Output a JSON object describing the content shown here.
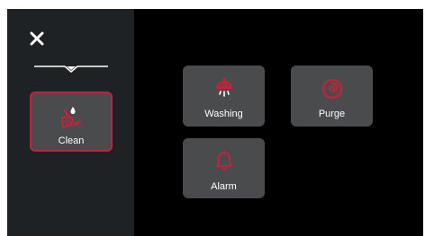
{
  "colors": {
    "background": "#000000",
    "sidebar": "#1f2225",
    "tile": "#4a4b4d",
    "accent": "#c0243b",
    "text": "#ffffff"
  },
  "sidebar": {
    "close_icon": "close-icon",
    "divider_icon": "chevron-divider-icon",
    "clean": {
      "label": "Clean",
      "icon": "clean-brush-icon",
      "selected": true
    }
  },
  "tiles": [
    {
      "label": "Washing",
      "icon": "washing-shower-icon"
    },
    {
      "label": "Purge",
      "icon": "purge-swirl-icon"
    },
    {
      "label": "Alarm",
      "icon": "alarm-bell-icon"
    }
  ]
}
